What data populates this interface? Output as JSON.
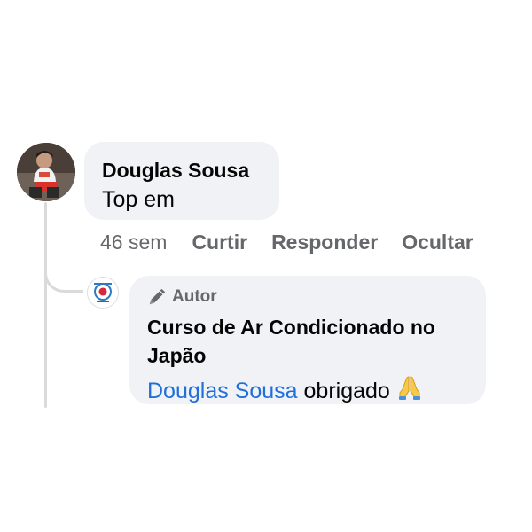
{
  "comment": {
    "author": "Douglas Sousa",
    "text": "Top em",
    "actions": {
      "time": "46 sem",
      "like": "Curtir",
      "reply": "Responder",
      "hide": "Ocultar"
    }
  },
  "reply": {
    "badge": "Autor",
    "badge_icon": "pen-icon",
    "author": "Curso de Ar Condicionado no Japão",
    "mention": "Douglas Sousa",
    "text": " obrigado",
    "emoji": "folded-hands-icon"
  },
  "colors": {
    "bubble": "#f0f2f5",
    "secondary_text": "#65676b",
    "mention_link": "#216fdb",
    "thread_line": "#d9dadc"
  }
}
